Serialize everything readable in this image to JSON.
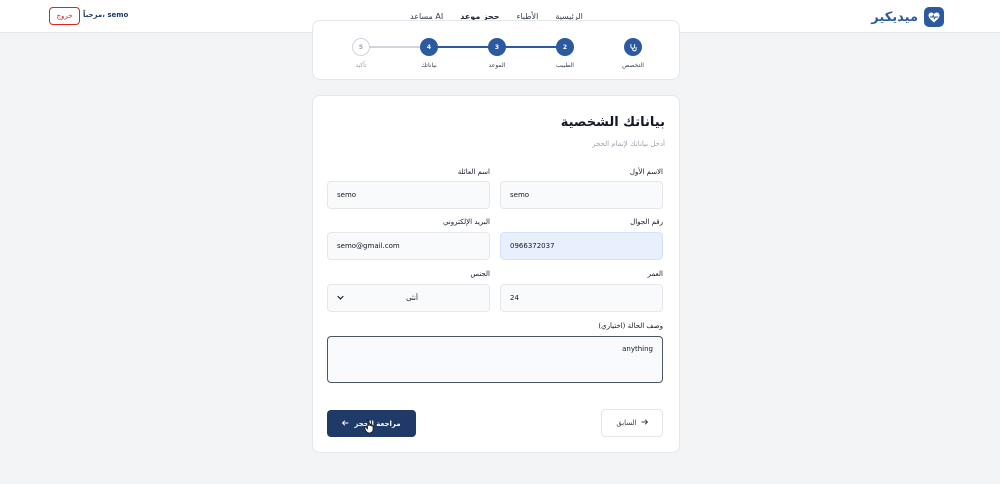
{
  "header": {
    "brand": "ميديكير",
    "nav": [
      {
        "label": "الرئيسية",
        "active": false
      },
      {
        "label": "الأطباء",
        "active": false
      },
      {
        "label": "حجز موعد",
        "active": true
      },
      {
        "label": "مساعد AI",
        "active": false
      }
    ],
    "greeting": "مرحباً، semo",
    "logout_label": "خروج"
  },
  "stepper": {
    "steps": [
      {
        "label": "التخصص",
        "state": "done",
        "icon": "stethoscope-icon",
        "number": ""
      },
      {
        "label": "الطبيب",
        "state": "done",
        "number": "2"
      },
      {
        "label": "الموعد",
        "state": "done",
        "number": "3"
      },
      {
        "label": "بياناتك",
        "state": "current",
        "number": "4"
      },
      {
        "label": "تأكيد",
        "state": "todo",
        "number": "5"
      }
    ]
  },
  "form": {
    "title": "بياناتك الشخصية",
    "subtitle": "أدخل بياناتك لإتمام الحجز",
    "first_name": {
      "label": "الاسم الأول",
      "value": "semo"
    },
    "last_name": {
      "label": "اسم العائلة",
      "value": "semo"
    },
    "phone": {
      "label": "رقم الجوال",
      "value": "0966372037"
    },
    "email": {
      "label": "البريد الإلكتروني",
      "value": "semo@gmail.com"
    },
    "age": {
      "label": "العمر",
      "value": "24"
    },
    "gender": {
      "label": "الجنس",
      "value": "أنثى"
    },
    "description": {
      "label": "وصف الحالة (اختياري)",
      "value": "anything"
    },
    "review_label": "مراجعة الحجز",
    "back_label": "السابق"
  },
  "colors": {
    "primary": "#1f3a68",
    "accent": "#2c5aa0",
    "danger": "#dc2626"
  }
}
